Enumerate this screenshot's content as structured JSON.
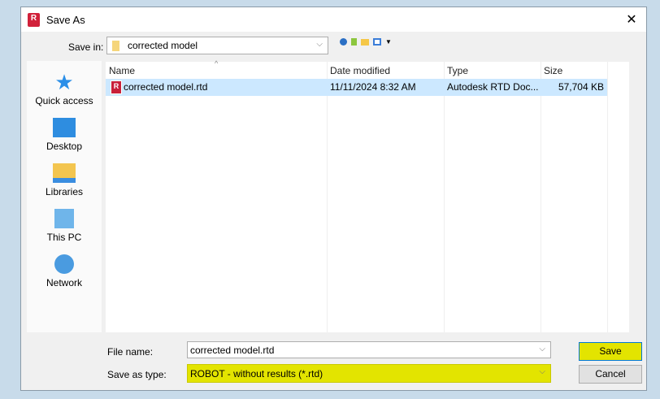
{
  "window": {
    "title": "Save As",
    "close": "✕"
  },
  "toolbar": {
    "save_in_label": "Save in:",
    "save_in_value": "corrected model"
  },
  "sidebar": {
    "items": [
      {
        "label": "Quick access"
      },
      {
        "label": "Desktop"
      },
      {
        "label": "Libraries"
      },
      {
        "label": "This PC"
      },
      {
        "label": "Network"
      }
    ]
  },
  "list": {
    "columns": [
      "Name",
      "Date modified",
      "Type",
      "Size"
    ],
    "rows": [
      {
        "name": "corrected model.rtd",
        "date": "11/11/2024 8:32 AM",
        "type": "Autodesk RTD Doc...",
        "size": "57,704 KB"
      }
    ]
  },
  "form": {
    "file_name_label": "File name:",
    "file_name_value": "corrected model.rtd",
    "type_label": "Save as type:",
    "type_value": "ROBOT - without results (*.rtd)",
    "save": "Save",
    "cancel": "Cancel"
  },
  "highlight_color": "#e3e400"
}
